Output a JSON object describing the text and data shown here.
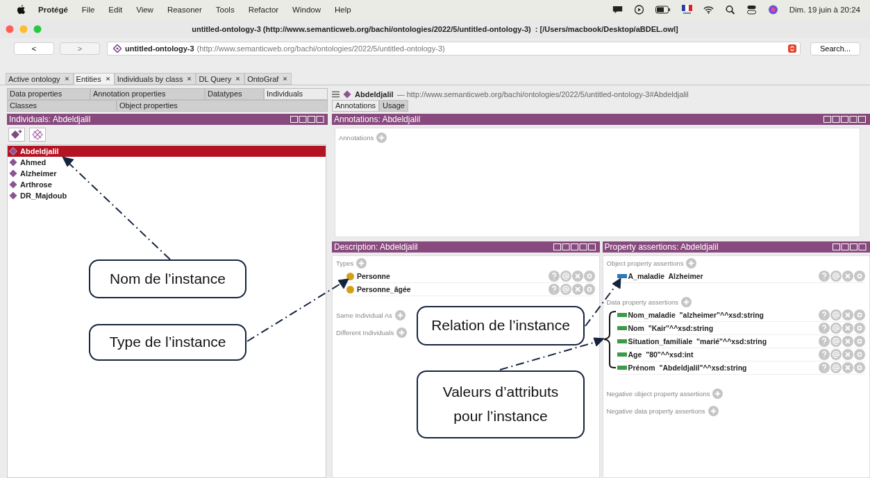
{
  "menubar": {
    "app": "Protégé",
    "items": [
      "File",
      "Edit",
      "View",
      "Reasoner",
      "Tools",
      "Refactor",
      "Window",
      "Help"
    ],
    "clock": "Dim. 19 juin à 20:24"
  },
  "window": {
    "title": "untitled-ontology-3 (http://www.semanticweb.org/bachi/ontologies/2022/5/untitled-ontology-3)  : [/Users/macbook/Desktop/aBDEL.owl]"
  },
  "toolbar": {
    "back": "<",
    "forward": ">",
    "ontology": "untitled-ontology-3",
    "iri": "(http://www.semanticweb.org/bachi/ontologies/2022/5/untitled-ontology-3)",
    "search": "Search..."
  },
  "tabs": [
    {
      "label": "Active ontology",
      "selected": false
    },
    {
      "label": "Entities",
      "selected": true
    },
    {
      "label": "Individuals by class",
      "selected": false
    },
    {
      "label": "DL Query",
      "selected": false
    },
    {
      "label": "OntoGraf",
      "selected": false
    }
  ],
  "entity_tabs": [
    [
      {
        "label": "Data properties",
        "selected": false
      },
      {
        "label": "Annotation properties",
        "selected": false
      },
      {
        "label": "Datatypes",
        "selected": false
      },
      {
        "label": "Individuals",
        "selected": true
      }
    ],
    [
      {
        "label": "Classes",
        "selected": false
      },
      {
        "label": "Object properties",
        "selected": false
      }
    ]
  ],
  "individuals_panel": {
    "title": "Individuals: Abdeldjalil",
    "help_button": false,
    "items": [
      {
        "label": "Abdeldjalil",
        "selected": true
      },
      {
        "label": "Ahmed",
        "selected": false
      },
      {
        "label": "Alzheimer",
        "selected": false
      },
      {
        "label": "Arthrose",
        "selected": false
      },
      {
        "label": "DR_Majdoub",
        "selected": false
      }
    ]
  },
  "entity_header": {
    "name": "Abdeldjalil",
    "iri": "— http://www.semanticweb.org/bachi/ontologies/2022/5/untitled-ontology-3#Abdeldjalil"
  },
  "view_tabs": [
    {
      "label": "Annotations",
      "selected": true
    },
    {
      "label": "Usage",
      "selected": false
    }
  ],
  "annotations_panel": {
    "title": "Annotations: Abdeldjalil",
    "help_button": true,
    "sections": [
      {
        "label": "Annotations"
      }
    ]
  },
  "description_panel": {
    "title": "Description: Abdeldjalil",
    "help_button": true,
    "sections": [
      {
        "label": "Types",
        "items": [
          {
            "text": "Personne",
            "kind": "class"
          },
          {
            "text": "Personne_âgée",
            "kind": "class"
          }
        ]
      },
      {
        "label": "Same Individual As"
      },
      {
        "label": "Different Individuals"
      }
    ]
  },
  "property_panel": {
    "title": "Property assertions: Abdeldjalil",
    "help_button": false,
    "sections": [
      {
        "label": "Object property assertions",
        "items": [
          {
            "text": "A_maladie  Alzheimer",
            "kind": "object"
          }
        ]
      },
      {
        "label": "Data property assertions",
        "items": [
          {
            "text": "Nom_maladie  \"alzheimer\"^^xsd:string",
            "kind": "data"
          },
          {
            "text": "Nom  \"Kair\"^^xsd:string",
            "kind": "data"
          },
          {
            "text": "Situation_familiale  \"marié\"^^xsd:string",
            "kind": "data"
          },
          {
            "text": "Age  \"80\"^^xsd:int",
            "kind": "data"
          },
          {
            "text": "Prénom  \"Abdeldjalil\"^^xsd:string",
            "kind": "data"
          }
        ]
      },
      {
        "label": "Negative object property assertions"
      },
      {
        "label": "Negative data property assertions"
      }
    ]
  },
  "callouts": [
    {
      "text": "Nom de l’instance"
    },
    {
      "text": "Type de l’instance"
    },
    {
      "text": "Relation de l’instance"
    },
    {
      "text": "Valeurs d’attributs\npour l’instance"
    }
  ]
}
